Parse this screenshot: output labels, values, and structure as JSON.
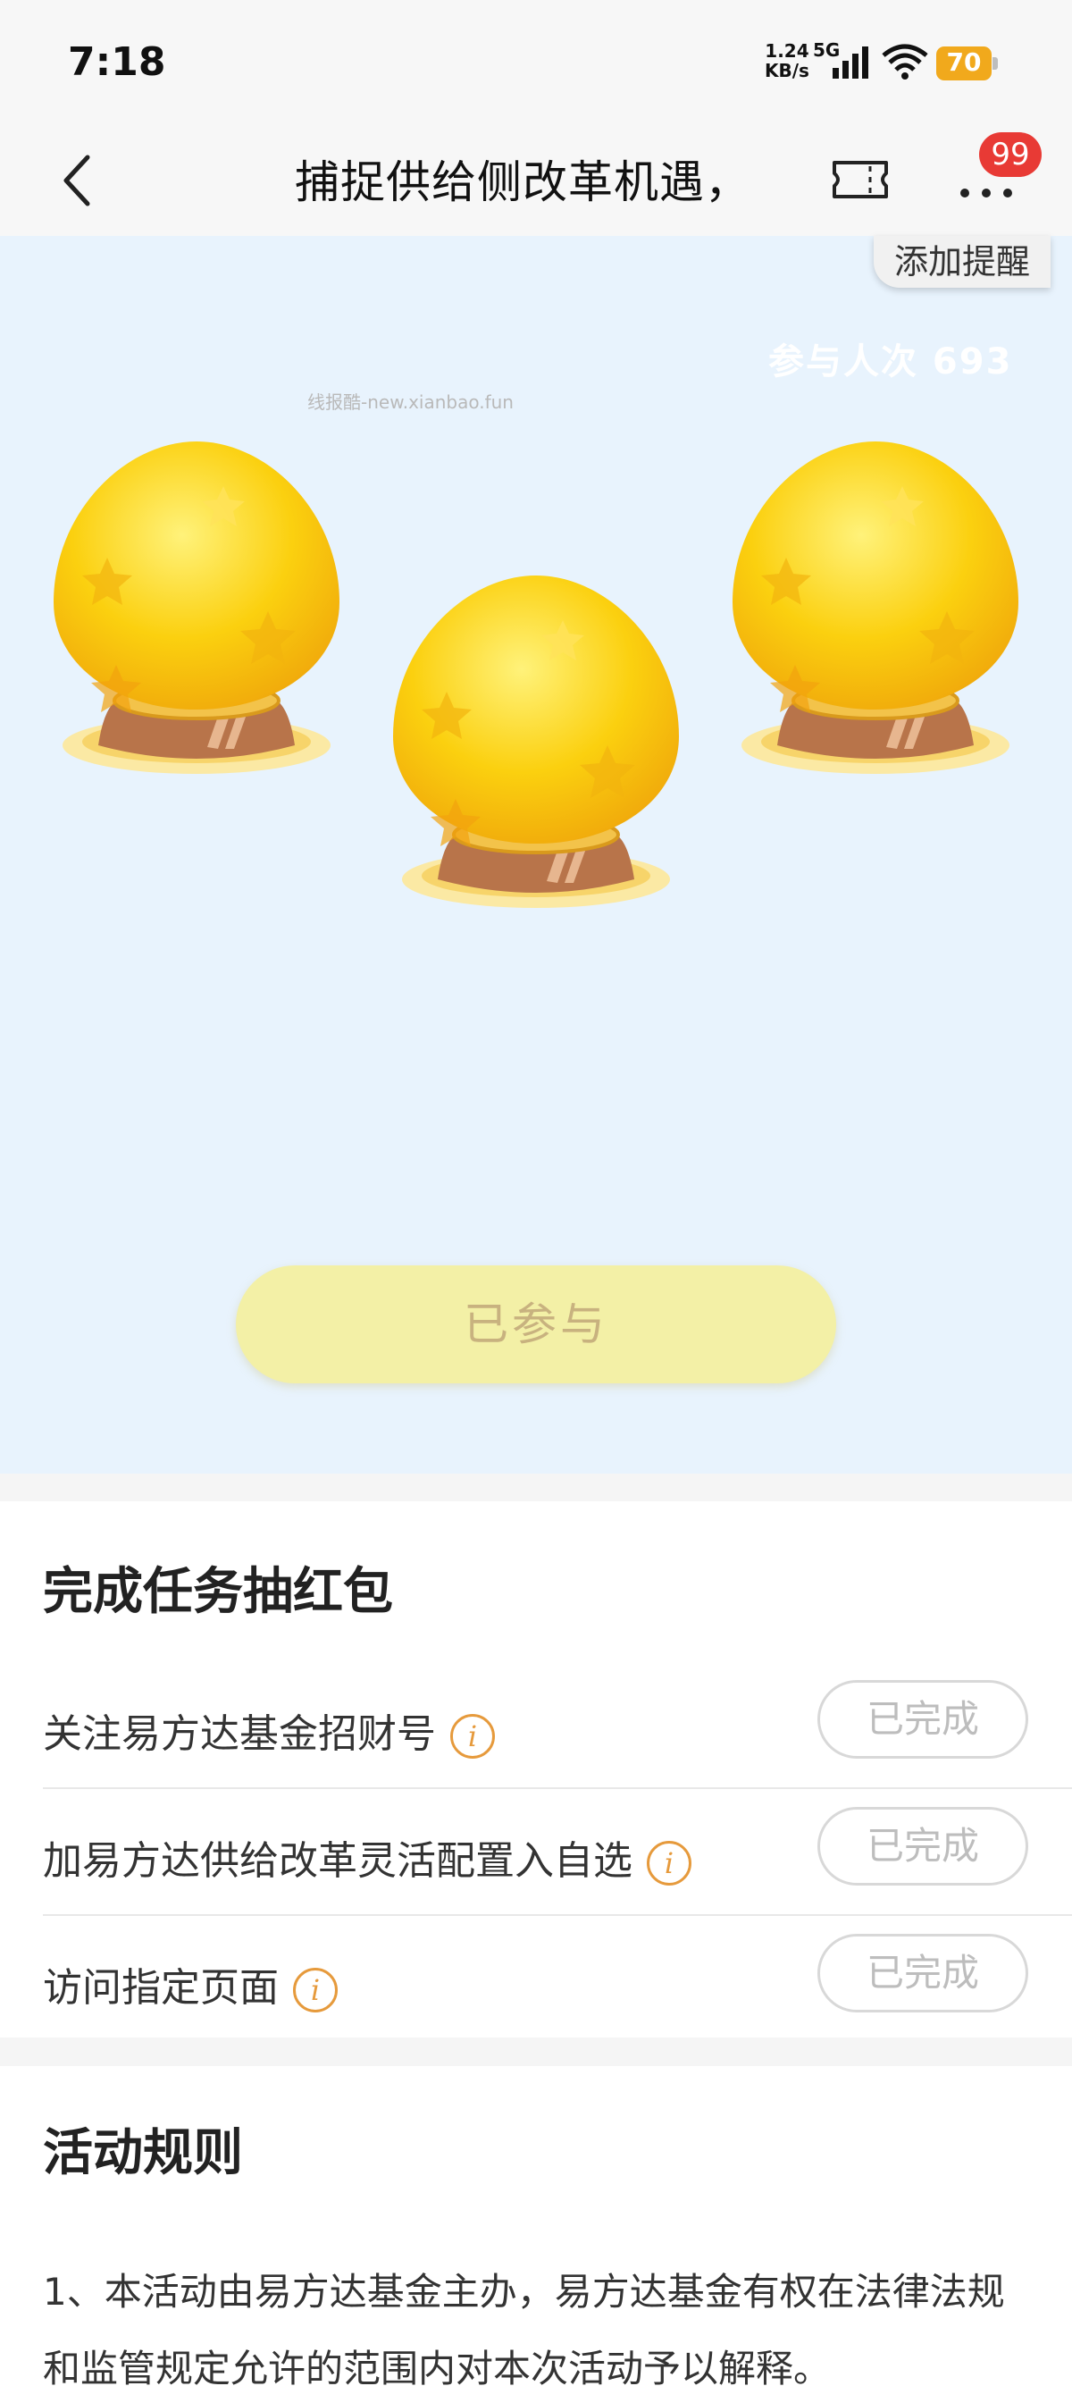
{
  "status_bar": {
    "time": "7:18",
    "net_speed_value": "1.24",
    "net_speed_unit": "KB/s",
    "network": "5G",
    "battery": "70",
    "icons": [
      "signal-icon",
      "wifi-icon",
      "battery-icon"
    ]
  },
  "nav": {
    "title": "捕捉供给侧改革机遇，",
    "badge": "99",
    "icons": [
      "back-arrow-icon",
      "ticket-icon",
      "more-icon"
    ]
  },
  "hero": {
    "remind_button": "添加提醒",
    "participants": "参与人次 693",
    "watermark": "线报酷-new.xianbao.fun",
    "joined_button": "已参与",
    "accent_colors": {
      "egg": "#f9c80e",
      "stand": "#b5714a",
      "button": "#f3f0a6"
    }
  },
  "tasks": {
    "title": "完成任务抽红包",
    "items": [
      {
        "label": "关注易方达基金招财号",
        "status": "已完成"
      },
      {
        "label": "加易方达供给改革灵活配置入自选",
        "status": "已完成"
      },
      {
        "label": "访问指定页面",
        "status": "已完成"
      }
    ],
    "info_glyph": "i"
  },
  "rules": {
    "title": "活动规则",
    "text": "1、本活动由易方达基金主办，易方达基金有权在法律法规和监管规定允许的范围内对本次活动予以解释。"
  }
}
